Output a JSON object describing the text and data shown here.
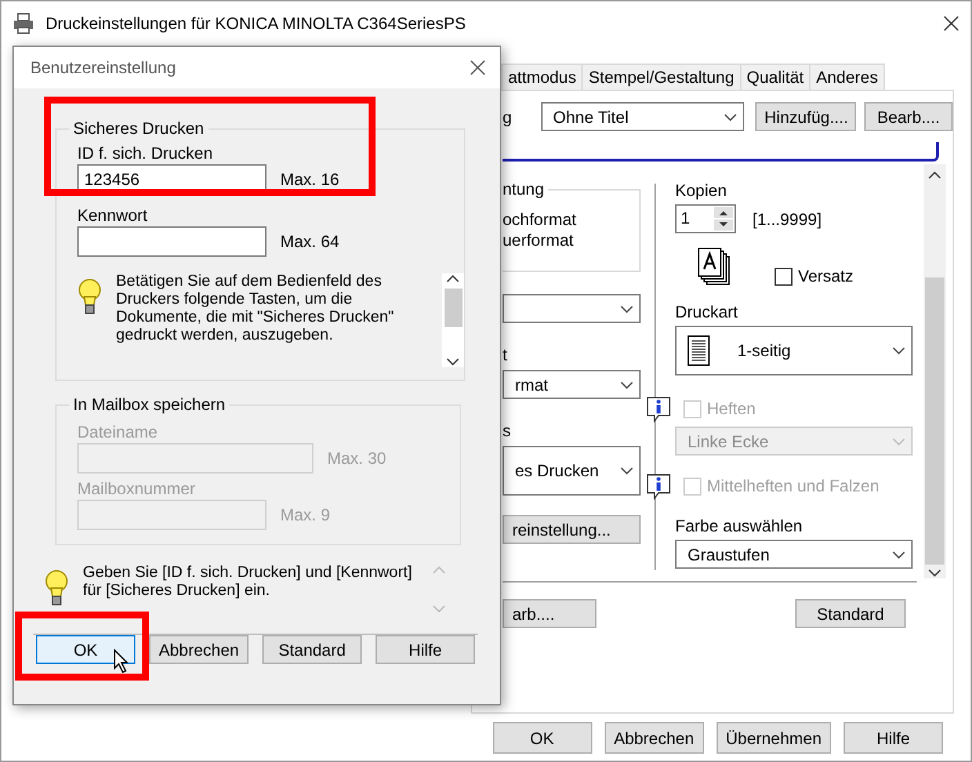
{
  "main_window": {
    "title": "Druckeinstellungen für KONICA MINOLTA C364SeriesPS",
    "tabs": [
      {
        "label": "attmodus",
        "selected": false
      },
      {
        "label": "Stempel/Gestaltung",
        "selected": false
      },
      {
        "label": "Qualität",
        "selected": false
      },
      {
        "label": "Anderes",
        "selected": false
      }
    ],
    "preset": {
      "label": "g",
      "value": "Ohne Titel",
      "buttons": [
        "Hinzufüg....",
        "Bearb...."
      ]
    },
    "left_column": {
      "group_title": "ntung",
      "group_options": [
        "ochformat",
        "uerformat"
      ],
      "controls": [
        {
          "kind": "select"
        },
        {
          "kind": "label",
          "text": "t"
        },
        {
          "kind": "select",
          "value": "rmat"
        },
        {
          "kind": "label",
          "text": "s"
        },
        {
          "kind": "select",
          "value": "es Drucken"
        },
        {
          "kind": "button",
          "text": "reinstellung..."
        }
      ]
    },
    "right_column": {
      "copies": {
        "label": "Kopien",
        "value": "1",
        "range": "[1...9999]"
      },
      "offset": {
        "label": "Versatz",
        "checked": false
      },
      "print_type": {
        "label": "Druckart",
        "value": "1-seitig"
      },
      "staple": {
        "label": "Heften",
        "checked": false,
        "disabled": true,
        "position": "Linke Ecke"
      },
      "fold": {
        "label": "Mittelheften und Falzen",
        "checked": false,
        "disabled": true
      },
      "color": {
        "label": "Farbe auswählen",
        "value": "Graustufen"
      }
    },
    "panel_buttons": [
      "arb....",
      "Standard"
    ],
    "buttons": [
      "OK",
      "Abbrechen",
      "Übernehmen",
      "Hilfe"
    ]
  },
  "dialog": {
    "title": "Benutzereinstellung",
    "secure_print": {
      "title": "Sicheres Drucken",
      "fields": [
        {
          "label": "ID f. sich. Drucken",
          "value": "123456",
          "max": "Max. 16",
          "highlighted": true
        },
        {
          "label": "Kennwort",
          "max": "Max. 64",
          "highlighted": false
        }
      ],
      "info": "Betätigen Sie auf dem Bedienfeld des Druckers folgende Tasten, um die Dokumente, die mit \"Sicheres Drucken\" gedruckt werden, auszugeben."
    },
    "mailbox": {
      "title": "In Mailbox speichern",
      "disabled": true,
      "fields": [
        {
          "label": "Dateiname",
          "max": "Max. 30"
        },
        {
          "label": "Mailboxnummer",
          "max": "Max. 9"
        }
      ]
    },
    "hint": "Geben Sie [ID f. sich. Drucken] und [Kennwort] für [Sicheres Drucken] ein.",
    "buttons": [
      {
        "label": "OK",
        "focused": true,
        "highlighted": true
      },
      {
        "label": "Abbrechen",
        "focused": false,
        "highlighted": false
      },
      {
        "label": "Standard",
        "focused": false,
        "highlighted": false
      },
      {
        "label": "Hilfe",
        "focused": false,
        "highlighted": false
      }
    ]
  }
}
